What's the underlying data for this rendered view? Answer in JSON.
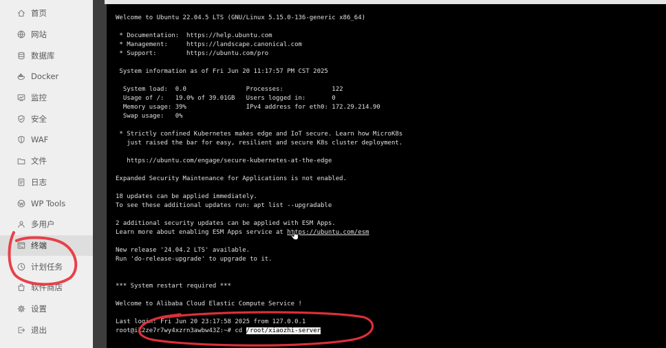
{
  "sidebar": {
    "items": [
      {
        "icon": "home-icon",
        "label": "首页"
      },
      {
        "icon": "globe-icon",
        "label": "网站"
      },
      {
        "icon": "database-icon",
        "label": "数据库"
      },
      {
        "icon": "docker-icon",
        "label": "Docker"
      },
      {
        "icon": "monitor-chart-icon",
        "label": "监控"
      },
      {
        "icon": "shield-check-icon",
        "label": "安全"
      },
      {
        "icon": "waf-shield-icon",
        "label": "WAF"
      },
      {
        "icon": "folder-icon",
        "label": "文件"
      },
      {
        "icon": "log-document-icon",
        "label": "日志"
      },
      {
        "icon": "wordpress-icon",
        "label": "WP Tools"
      },
      {
        "icon": "user-icon",
        "label": "多用户"
      },
      {
        "icon": "terminal-icon",
        "label": "终端",
        "active": true
      },
      {
        "icon": "clock-icon",
        "label": "计划任务"
      },
      {
        "icon": "shopping-bag-icon",
        "label": "软件商店"
      },
      {
        "icon": "gear-icon",
        "label": "设置"
      },
      {
        "icon": "logout-icon",
        "label": "退出"
      }
    ]
  },
  "terminal": {
    "lines": [
      "Welcome to Ubuntu 22.04.5 LTS (GNU/Linux 5.15.0-136-generic x86_64)",
      " * Documentation:  https://help.ubuntu.com",
      " * Management:     https://landscape.canonical.com",
      " * Support:        https://ubuntu.com/pro",
      " System information as of Fri Jun 20 11:17:57 PM CST 2025",
      "  System load:  0.0                Processes:             122",
      "  Usage of /:   19.0% of 39.01GB   Users logged in:       0",
      "  Memory usage: 39%                IPv4 address for eth0: 172.29.214.90",
      "  Swap usage:   0%",
      " * Strictly confined Kubernetes makes edge and IoT secure. Learn how MicroK8s",
      "   just raised the bar for easy, resilient and secure K8s cluster deployment.",
      "   https://ubuntu.com/engage/secure-kubernetes-at-the-edge",
      "Expanded Security Maintenance for Applications is not enabled.",
      "18 updates can be applied immediately.",
      "To see these additional updates run: apt list --upgradable",
      "2 additional security updates can be applied with ESM Apps.",
      "New release '24.04.2 LTS' available.",
      "Run 'do-release-upgrade' to upgrade to it.",
      "*** System restart required ***",
      "Welcome to Alibaba Cloud Elastic Compute Service !",
      "Last login: Fri Jun 20 23:17:58 2025 from 127.0.0.1"
    ],
    "esm_line": {
      "prefix": "Learn more about enabling ESM Apps service at ",
      "link": "https://ubuntu.com/esm"
    },
    "prompt": {
      "text": "root@iZ2ze7r7wy4xzrn3awbw43Z:~# cd ",
      "selected": "/root/xiaozhi-server"
    }
  },
  "cursor_icon": "hand-pointer-icon",
  "colors": {
    "sidebar_bg": "#efefef",
    "sidebar_active_bg": "#dedede",
    "divider": "#3d3d3d",
    "terminal_bg": "#000000",
    "terminal_text": "#e0e0e0",
    "selection_bg": "#f2f2f2",
    "annotation": "#e8323c"
  }
}
